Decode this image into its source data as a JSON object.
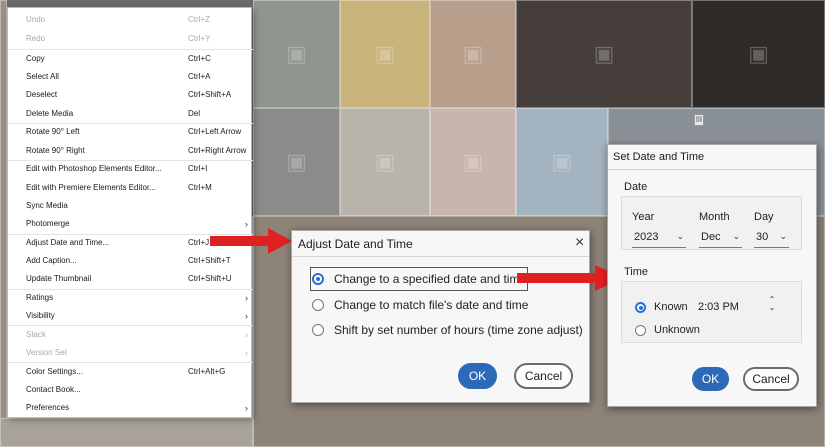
{
  "context_menu": {
    "items": [
      {
        "label": "Undo",
        "shortcut": "Ctrl+Z",
        "disabled": true
      },
      {
        "label": "Redo",
        "shortcut": "Ctrl+Y",
        "disabled": true
      },
      {
        "label": "Copy",
        "shortcut": "Ctrl+C"
      },
      {
        "label": "Select All",
        "shortcut": "Ctrl+A"
      },
      {
        "label": "Deselect",
        "shortcut": "Ctrl+Shift+A"
      },
      {
        "label": "Delete Media",
        "shortcut": "Del"
      },
      {
        "label": "Rotate 90° Left",
        "shortcut": "Ctrl+Left Arrow"
      },
      {
        "label": "Rotate 90° Right",
        "shortcut": "Ctrl+Right Arrow"
      },
      {
        "label": "Edit with Photoshop Elements Editor...",
        "shortcut": "Ctrl+I"
      },
      {
        "label": "Edit with Premiere Elements Editor...",
        "shortcut": "Ctrl+M"
      },
      {
        "label": "Sync Media",
        "shortcut": ""
      },
      {
        "label": "Photomerge",
        "shortcut": "",
        "submenu": true
      },
      {
        "label": "Adjust Date and Time...",
        "shortcut": "Ctrl+J"
      },
      {
        "label": "Add Caption...",
        "shortcut": "Ctrl+Shift+T"
      },
      {
        "label": "Update Thumbnail",
        "shortcut": "Ctrl+Shift+U"
      },
      {
        "label": "Ratings",
        "shortcut": "",
        "submenu": true
      },
      {
        "label": "Visibility",
        "shortcut": "",
        "submenu": true
      },
      {
        "label": "Stack",
        "shortcut": "",
        "submenu": true,
        "disabled": true
      },
      {
        "label": "Version Set",
        "shortcut": "",
        "submenu": true,
        "disabled": true
      },
      {
        "label": "Color Settings...",
        "shortcut": "Ctrl+Alt+G"
      },
      {
        "label": "Contact Book...",
        "shortcut": ""
      },
      {
        "label": "Preferences",
        "shortcut": "",
        "submenu": true
      }
    ]
  },
  "icons": {
    "submenu_arrow": "chevron-right-icon",
    "close": "close-icon",
    "chevron": "chevron-down-icon"
  },
  "adjust_dialog": {
    "title": "Adjust Date and Time",
    "options": [
      "Change to a specified date and time",
      "Change to match file's date and time",
      "Shift by set number of hours (time zone adjust)"
    ],
    "selected_option": 0,
    "ok_label": "OK",
    "cancel_label": "Cancel"
  },
  "set_dialog": {
    "title": "Set Date and Time",
    "date_label": "Date",
    "year_label": "Year",
    "month_label": "Month",
    "day_label": "Day",
    "year_value": "2023",
    "month_value": "Dec",
    "day_value": "30",
    "time_label": "Time",
    "known_label": "Known",
    "time_value": "2:03 PM",
    "unknown_label": "Unknown",
    "selected_time_option": "Known",
    "ok_label": "OK",
    "cancel_label": "Cancel"
  },
  "colors": {
    "accent": "#2c6ab7",
    "arrow": "#e02121",
    "radio": "#2b6fd6"
  },
  "photo_tiles": [
    {
      "name": "gallery-photo",
      "color": "#9aa39a"
    },
    {
      "name": "gallery-photo",
      "color": "#c4a79a"
    },
    {
      "name": "gallery-photo",
      "color": "#d6c3a0"
    },
    {
      "name": "gallery-photo",
      "color": "#5a4d44"
    },
    {
      "name": "gallery-photo",
      "color": "#3b3631"
    },
    {
      "name": "gallery-photo",
      "color": "#8a8a88"
    },
    {
      "name": "gallery-photo",
      "color": "#b7b2a8"
    },
    {
      "name": "gallery-photo",
      "color": "#c7b4aa"
    },
    {
      "name": "gallery-photo",
      "color": "#a9b8c3"
    },
    {
      "name": "gallery-photo",
      "color": "#7e868d"
    },
    {
      "name": "gallery-photo",
      "color": "#8f8477"
    },
    {
      "name": "gallery-photo",
      "color": "#9b8d81"
    },
    {
      "name": "gallery-photo",
      "color": "#8d9499"
    },
    {
      "name": "gallery-photo",
      "color": "#a6a099"
    }
  ]
}
